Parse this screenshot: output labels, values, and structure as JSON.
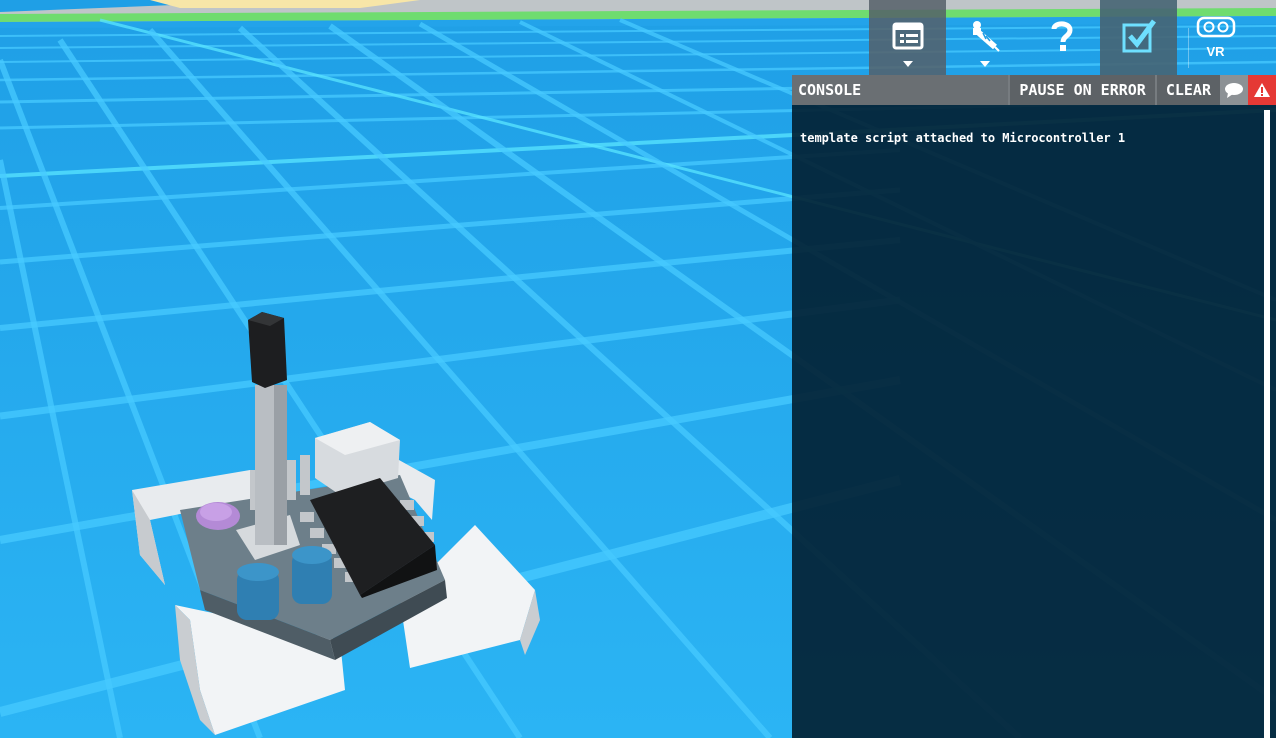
{
  "toolbar": {
    "buttons": [
      {
        "name": "console-icon",
        "style": "dark",
        "dropdown": true
      },
      {
        "name": "probe-icon",
        "style": "clear",
        "dropdown": true
      },
      {
        "name": "help-icon",
        "style": "clear",
        "dropdown": false
      },
      {
        "name": "checkbox-icon",
        "style": "teal",
        "dropdown": false
      }
    ],
    "vr_label": "VR"
  },
  "console": {
    "title": "CONSOLE",
    "pause_on_error": "PAUSE ON ERROR",
    "clear": "CLEAR",
    "messages": [
      "template script attached to Microcontroller 1"
    ]
  },
  "colors": {
    "ground": "#29a8ec",
    "grid": "#4fd2ff",
    "panel": "#021e30",
    "header": "#6a6f73",
    "warn": "#e53935"
  }
}
